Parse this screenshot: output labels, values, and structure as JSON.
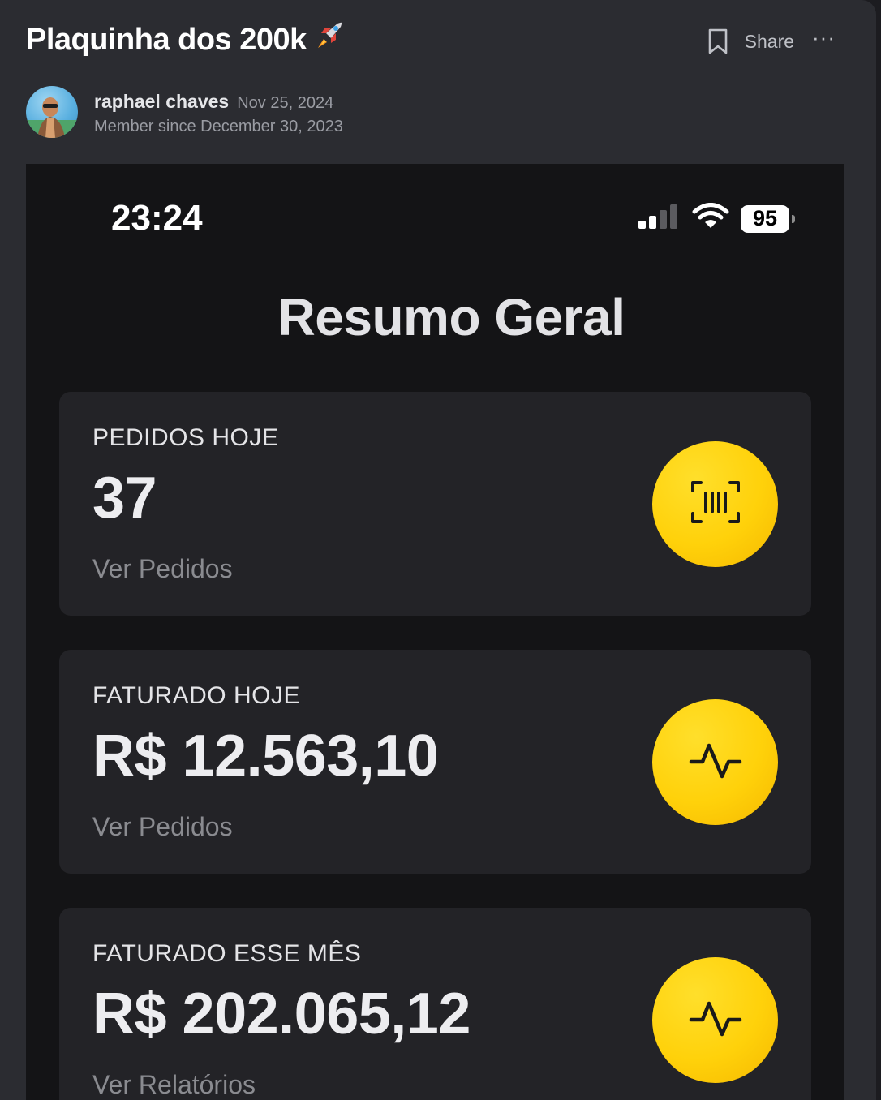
{
  "post": {
    "title": "Plaquinha dos 200k",
    "actions": {
      "share_label": "Share",
      "more_label": "···"
    },
    "author": {
      "name": "raphael chaves",
      "date": "Nov 25, 2024",
      "member_since": "Member since December 30, 2023"
    }
  },
  "phone": {
    "status": {
      "time": "23:24",
      "battery": "95"
    },
    "heading": "Resumo Geral",
    "cards": [
      {
        "label": "PEDIDOS HOJE",
        "value": "37",
        "link": "Ver Pedidos",
        "icon": "barcode-scan-icon"
      },
      {
        "label": "FATURADO HOJE",
        "value": "R$ 12.563,10",
        "link": "Ver Pedidos",
        "icon": "activity-icon"
      },
      {
        "label": "FATURADO ESSE MÊS",
        "value": "R$ 202.065,12",
        "link": "Ver Relatórios",
        "icon": "activity-icon"
      }
    ]
  },
  "colors": {
    "accent": "#ffd10a",
    "card_bg": "#232327",
    "screen_bg": "#141416",
    "page_bg": "#2b2c31"
  }
}
